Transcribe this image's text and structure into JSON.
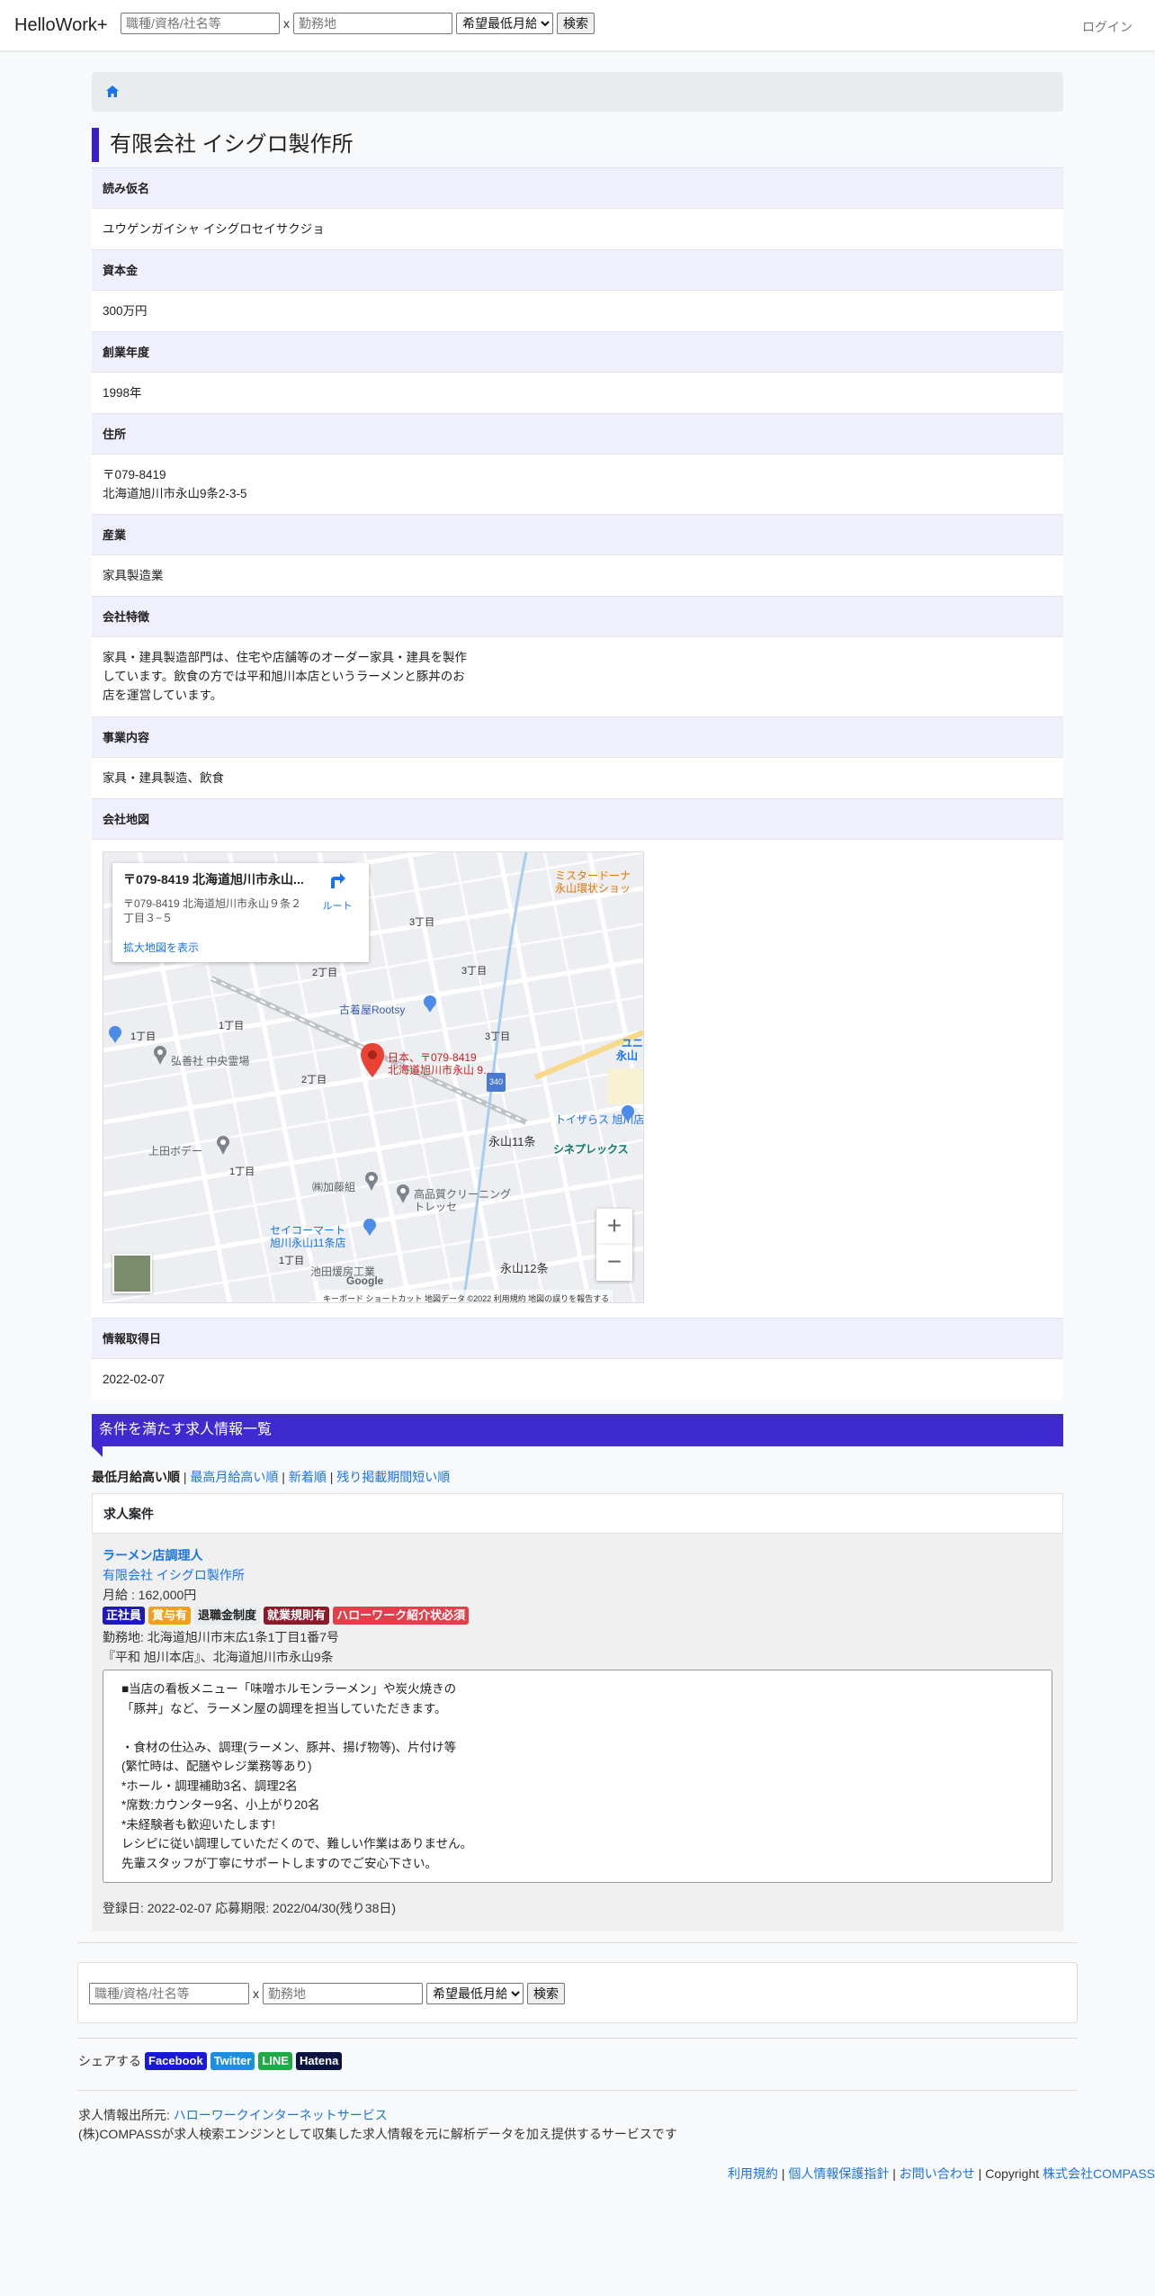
{
  "header": {
    "brand": "HelloWork+",
    "search_placeholder": "職種/資格/社名等",
    "location_placeholder": "勤務地",
    "separator": "x",
    "salary_select": "希望最低月給",
    "search_button": "検索",
    "login": "ログイン"
  },
  "company": {
    "name": "有限会社 イシグロ製作所",
    "sections": {
      "reading_label": "読み仮名",
      "reading": "ユウゲンガイシャ イシグロセイサクジョ",
      "capital_label": "資本金",
      "capital": "300万円",
      "founded_label": "創業年度",
      "founded": "1998年",
      "address_label": "住所",
      "postal": "〒079-8419",
      "address": "北海道旭川市永山9条2-3-5",
      "industry_label": "産業",
      "industry": "家具製造業",
      "features_label": "会社特徴",
      "features_1": "家具・建具製造部門は、住宅や店舗等のオーダー家具・建具を製作",
      "features_2": "しています。飲食の方では平和旭川本店というラーメンと豚丼のお",
      "features_3": "店を運営しています。",
      "business_label": "事業内容",
      "business": "家具・建具製造、飲食",
      "map_label": "会社地図",
      "date_label": "情報取得日",
      "date": "2022-02-07"
    }
  },
  "map": {
    "card_title": "〒079-8419 北海道旭川市永山...",
    "card_addr_1": "〒079-8419 北海道旭川市永山９条２",
    "card_addr_2": "丁目３−５",
    "card_link": "拡大地図を表示",
    "route": "ルート",
    "pin_label_1": "日本、〒079-8419",
    "pin_label_2": "北海道旭川市永山 9…",
    "labels": {
      "rootsy": "古着屋Rootsy",
      "kouseisha": "弘善社 中央霊場",
      "ueda": "上田ボデー",
      "kato": "㈱加藤組",
      "cleaning_1": "高品質クリーニング",
      "cleaning_2": "トレッセ",
      "seicomart_1": "セイコーマート",
      "seicomart_2": "旭川永山11条店",
      "ikeda": "池田煖房工業",
      "tozaras": "トイザらス 旭川店",
      "cinema": "シネプレックス",
      "mister_1": "ミスタードーナ",
      "mister_2": "永山環状ショッ",
      "nagayama11": "永山11条",
      "nagayama12": "永山12条",
      "chome3a": "3丁目",
      "chome3b": "3丁目",
      "chome3c": "3丁目",
      "chome2a": "2丁目",
      "chome2b": "2丁目",
      "chome1a": "1丁目",
      "chome1b": "1丁目",
      "chome1c": "1丁目",
      "chome1d": "1丁目",
      "road": "340",
      "yuni": "ユニ",
      "yuni2": "永山",
      "google": "Google"
    },
    "footer": "キーボード ショートカット  地図データ ©2022   利用規約   地図の誤りを報告する"
  },
  "jobs": {
    "heading": "条件を満たす求人情報一覧",
    "sort_current": "最低月給高い順",
    "sort_sep": " | ",
    "sort_1": "最高月給高い順",
    "sort_2": "新着順",
    "sort_3": "残り掲載期間短い順",
    "list_label": "求人案件",
    "items": [
      {
        "title": "ラーメン店調理人",
        "company": "有限会社 イシグロ製作所",
        "salary": "月給 : 162,000円",
        "badges": [
          "正社員",
          "賞与有",
          "退職金制度",
          "就業規則有",
          "ハローワーク紹介状必須"
        ],
        "location": "勤務地: 北海道旭川市末広1条1丁目1番7号",
        "location2": "『平和 旭川本店』、北海道旭川市永山9条",
        "description": "■当店の看板メニュー「味噌ホルモンラーメン」や炭火焼きの\n「豚丼」など、ラーメン屋の調理を担当していただきます。\n\n・食材の仕込み、調理(ラーメン、豚丼、揚げ物等)、片付け等\n(繁忙時は、配膳やレジ業務等あり)\n*ホール・調理補助3名、調理2名\n*席数:カウンター9名、小上がり20名\n*未経験者も歓迎いたします!\nレシピに従い調理していただくので、難しい作業はありません。\n先輩スタッフが丁寧にサポートしますのでご安心下さい。",
        "registered": "登録日: 2022-02-07 応募期限: 2022/04/30(残り38日)"
      }
    ]
  },
  "footer": {
    "share_label": "シェアする",
    "facebook": "Facebook",
    "twitter": "Twitter",
    "line": "LINE",
    "hatena": "Hatena",
    "source_label": "求人情報出所元: ",
    "source_link": "ハローワークインターネットサービス",
    "source_desc": "(株)COMPASSが求人検索エンジンとして収集した求人情報を元に解析データを加え提供するサービスです",
    "terms": "利用規約",
    "privacy": "個人情報保護指針",
    "contact": "お問い合わせ",
    "copyright_text": "Copyright ",
    "company_link": "株式会社COMPASS"
  },
  "colors": {
    "accent": "#3f2acf",
    "link": "#1a73e8",
    "badge_fulltime": "#1d1ab8",
    "badge_bonus": "#f0a021",
    "badge_retire": "#e9ecef",
    "badge_rules": "#8b1a2b",
    "badge_hw": "#e0404a"
  }
}
